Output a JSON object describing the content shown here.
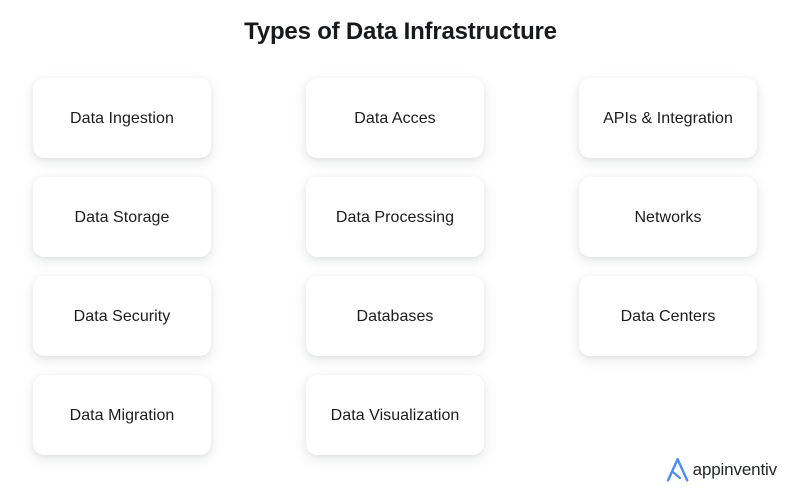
{
  "header": {
    "title": "Types of Data Infrastructure"
  },
  "columns": [
    {
      "name": "column-1",
      "cards": [
        {
          "label": "Data Ingestion"
        },
        {
          "label": "Data Storage"
        },
        {
          "label": "Data Security"
        },
        {
          "label": "Data Migration"
        }
      ]
    },
    {
      "name": "column-2",
      "cards": [
        {
          "label": "Data Acces"
        },
        {
          "label": "Data Processing"
        },
        {
          "label": "Databases"
        },
        {
          "label": "Data Visualization"
        }
      ]
    },
    {
      "name": "column-3",
      "cards": [
        {
          "label": "APIs & Integration"
        },
        {
          "label": "Networks"
        },
        {
          "label": "Data Centers"
        }
      ]
    }
  ],
  "branding": {
    "mark_icon": "appinventiv-a-mark-icon",
    "wordmark": "appinventiv",
    "mark_color": "#4b8df8",
    "wordmark_color": "#232629"
  },
  "theme": {
    "background": "#ffffff",
    "card_background": "#ffffff",
    "title_color": "#18191b",
    "card_text_color": "#1b1c1e"
  }
}
